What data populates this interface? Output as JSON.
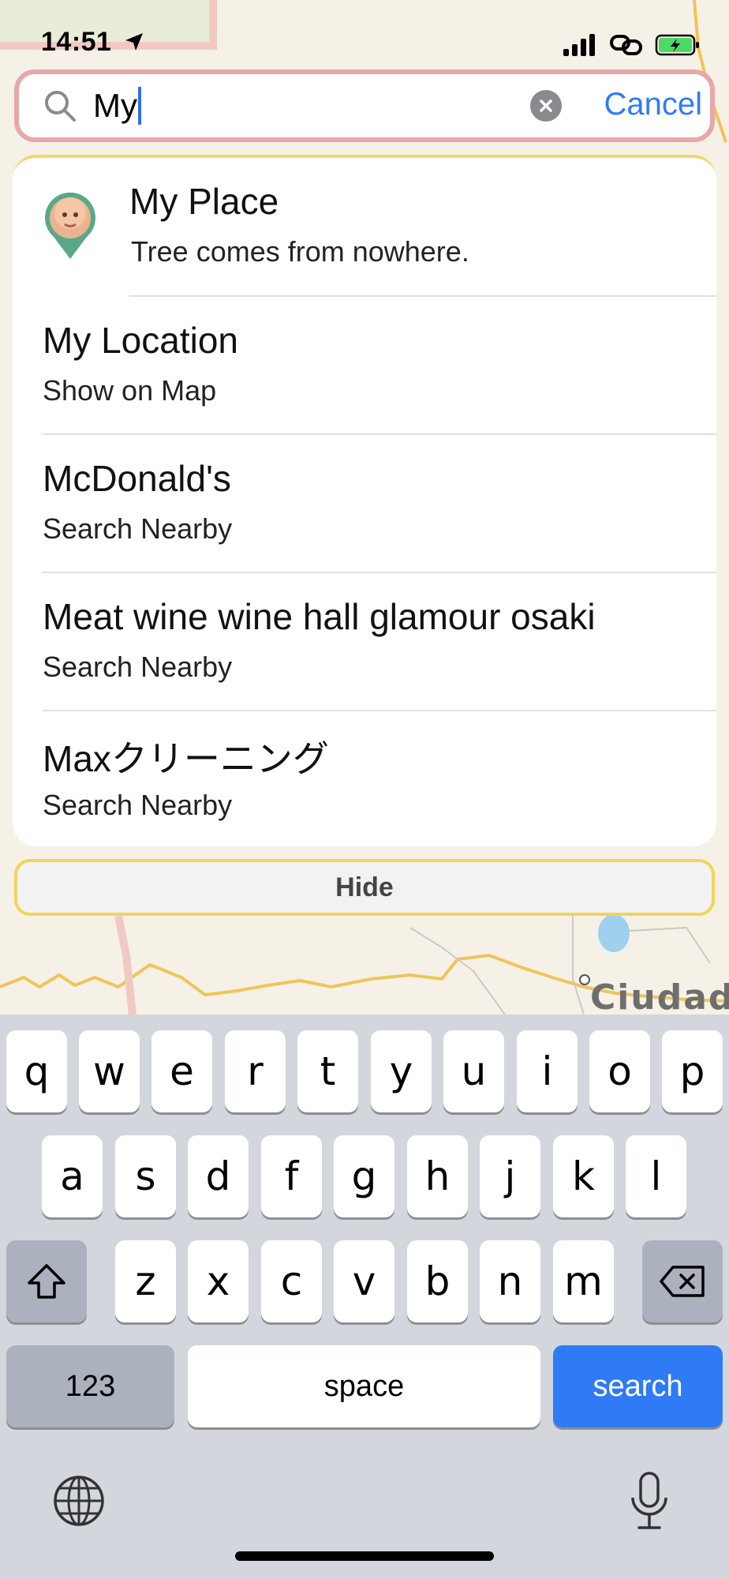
{
  "status_bar": {
    "time": "14:51"
  },
  "search": {
    "query": "My",
    "cancel_label": "Cancel"
  },
  "results": [
    {
      "title": "My Place",
      "subtitle": "Tree comes from nowhere."
    },
    {
      "title": "My Location",
      "subtitle": "Show on Map"
    },
    {
      "title": "McDonald's",
      "subtitle": "Search Nearby"
    },
    {
      "title": "Meat wine wine hall glamour osaki",
      "subtitle": "Search Nearby"
    },
    {
      "title": "Maxクリーニング",
      "subtitle": "Search Nearby"
    }
  ],
  "hide_label": "Hide",
  "map": {
    "city_label": "Ciudad"
  },
  "keyboard": {
    "row1": [
      "q",
      "w",
      "e",
      "r",
      "t",
      "y",
      "u",
      "i",
      "o",
      "p"
    ],
    "row2": [
      "a",
      "s",
      "d",
      "f",
      "g",
      "h",
      "j",
      "k",
      "l"
    ],
    "row3": [
      "z",
      "x",
      "c",
      "v",
      "b",
      "n",
      "m"
    ],
    "numbers_label": "123",
    "space_label": "space",
    "search_label": "search"
  },
  "colors": {
    "accent": "#2f7bf6",
    "search_border": "#e8a7aa",
    "hide_border": "#f0d55a"
  },
  "icons": [
    "location-arrow-icon",
    "signal-icon",
    "link-icon",
    "battery-icon",
    "search-icon",
    "clear-icon",
    "place-pin-icon",
    "shift-icon",
    "backspace-icon",
    "globe-icon",
    "microphone-icon"
  ]
}
